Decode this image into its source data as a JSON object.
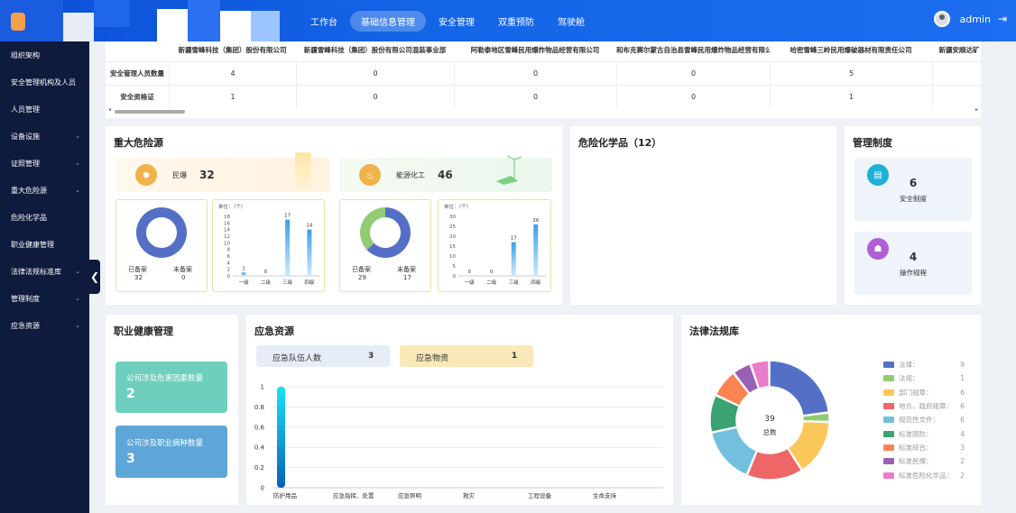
{
  "nav": {
    "items": [
      "工作台",
      "基础信息管理",
      "安全管理",
      "双重预防",
      "驾驶舱"
    ],
    "active_index": 1
  },
  "user": {
    "name": "admin"
  },
  "sidebar": {
    "items": [
      {
        "label": "组织架构",
        "chevron": false
      },
      {
        "label": "安全管理机构及人员",
        "chevron": false
      },
      {
        "label": "人员管理",
        "chevron": false
      },
      {
        "label": "设备设施",
        "chevron": true
      },
      {
        "label": "证照管理",
        "chevron": true
      },
      {
        "label": "重大危险源",
        "chevron": true
      },
      {
        "label": "危险化学品",
        "chevron": false
      },
      {
        "label": "职业健康管理",
        "chevron": false
      },
      {
        "label": "法律法规标准库",
        "chevron": true
      },
      {
        "label": "管理制度",
        "chevron": true
      },
      {
        "label": "应急资源",
        "chevron": true
      }
    ]
  },
  "company_table": {
    "columns": [
      "新疆雪峰科技（集团）股份有限公司",
      "新疆雪峰科技（集团）股份有限公司混装事业部",
      "阿勒泰地区雪峰民用爆炸物品经营有限公司",
      "和布克赛尔蒙古自治县雪峰民用爆炸物品经营有限公司",
      "哈密雪峰三岭民用爆破器材有限责任公司",
      "新疆安顺达矿"
    ],
    "rows": [
      {
        "label": "安全管理人员数量",
        "values": [
          "4",
          "0",
          "0",
          "0",
          "5",
          ""
        ]
      },
      {
        "label": "安全资格证",
        "values": [
          "1",
          "0",
          "0",
          "0",
          "1",
          ""
        ]
      }
    ]
  },
  "major_hazard": {
    "title": "重大危险源",
    "groups": [
      {
        "name": "民爆",
        "count": "32",
        "filed_label": "已备案",
        "filed": "32",
        "unfiled_label": "未备案",
        "unfiled": "0",
        "unit_label": "单位：（个）",
        "levels": [
          "一级",
          "二级",
          "三级",
          "四级"
        ],
        "level_values": [
          1,
          0,
          17,
          14
        ],
        "ymax": 18,
        "yticks": [
          0,
          2,
          4,
          6,
          8,
          10,
          12,
          14,
          16,
          18
        ]
      },
      {
        "name": "能源化工",
        "count": "46",
        "filed_label": "已备案",
        "filed": "29",
        "unfiled_label": "未备案",
        "unfiled": "17",
        "unit_label": "单位：（个）",
        "levels": [
          "一级",
          "二级",
          "三级",
          "四级"
        ],
        "level_values": [
          0,
          0,
          17,
          26
        ],
        "ymax": 30,
        "yticks": [
          0,
          5,
          10,
          15,
          20,
          25,
          30
        ]
      }
    ]
  },
  "hazardous_chem": {
    "title": "危险化学品（12）"
  },
  "mgmt_system": {
    "title": "管理制度",
    "items": [
      {
        "value": "6",
        "label": "安全制度"
      },
      {
        "value": "4",
        "label": "操作规程"
      }
    ]
  },
  "occupational": {
    "title": "职业健康管理",
    "items": [
      {
        "label": "公司涉及危害因素数量",
        "value": "2"
      },
      {
        "label": "公司涉及职业病种数量",
        "value": "3"
      }
    ]
  },
  "emergency": {
    "title": "应急资源",
    "team_label": "应急队伍人数",
    "team_value": "3",
    "supply_label": "应急物资",
    "supply_value": "1"
  },
  "laws": {
    "title": "法律法规库",
    "total": "39",
    "total_label": "总数"
  },
  "chart_data": [
    {
      "type": "pie",
      "title": "",
      "labels": [
        "已备案",
        "未备案"
      ],
      "values": [
        32,
        0
      ],
      "colors": [
        "#5470c6",
        "#91cc75"
      ]
    },
    {
      "type": "bar",
      "title": "",
      "ylabel": "单位：（个）",
      "categories": [
        "一级",
        "二级",
        "三级",
        "四级"
      ],
      "values": [
        1,
        0,
        17,
        14
      ],
      "ylim": [
        0,
        18
      ]
    },
    {
      "type": "pie",
      "title": "",
      "labels": [
        "已备案",
        "未备案"
      ],
      "values": [
        29,
        17
      ],
      "colors": [
        "#5470c6",
        "#91cc75"
      ]
    },
    {
      "type": "bar",
      "title": "",
      "ylabel": "单位：（个）",
      "categories": [
        "一级",
        "二级",
        "三级",
        "四级"
      ],
      "values": [
        0,
        0,
        17,
        26
      ],
      "ylim": [
        0,
        30
      ]
    },
    {
      "type": "bar",
      "title": "",
      "categories": [
        "防护用品",
        "应急指挥、处置",
        "应急照明",
        "救灾",
        "工程设备",
        "生命支持"
      ],
      "values": [
        1,
        0,
        0,
        0,
        0,
        0
      ],
      "ylim": [
        0,
        1
      ],
      "yticks": [
        0,
        0.2,
        0.4,
        0.6,
        0.8,
        1
      ]
    },
    {
      "type": "pie",
      "title": "",
      "labels": [
        "法律：",
        "法规：",
        "部门规章：",
        "地方、政府规章：",
        "规范性文件：",
        "标准国防：",
        "标准综合：",
        "标准民爆：",
        "标准危险化学品："
      ],
      "values": [
        9,
        1,
        6,
        6,
        6,
        4,
        3,
        2,
        2
      ],
      "colors": [
        "#5470c6",
        "#91cc75",
        "#fac858",
        "#ee6666",
        "#73c0de",
        "#3ba272",
        "#fc8452",
        "#9a60b4",
        "#ea7ccc"
      ]
    }
  ]
}
